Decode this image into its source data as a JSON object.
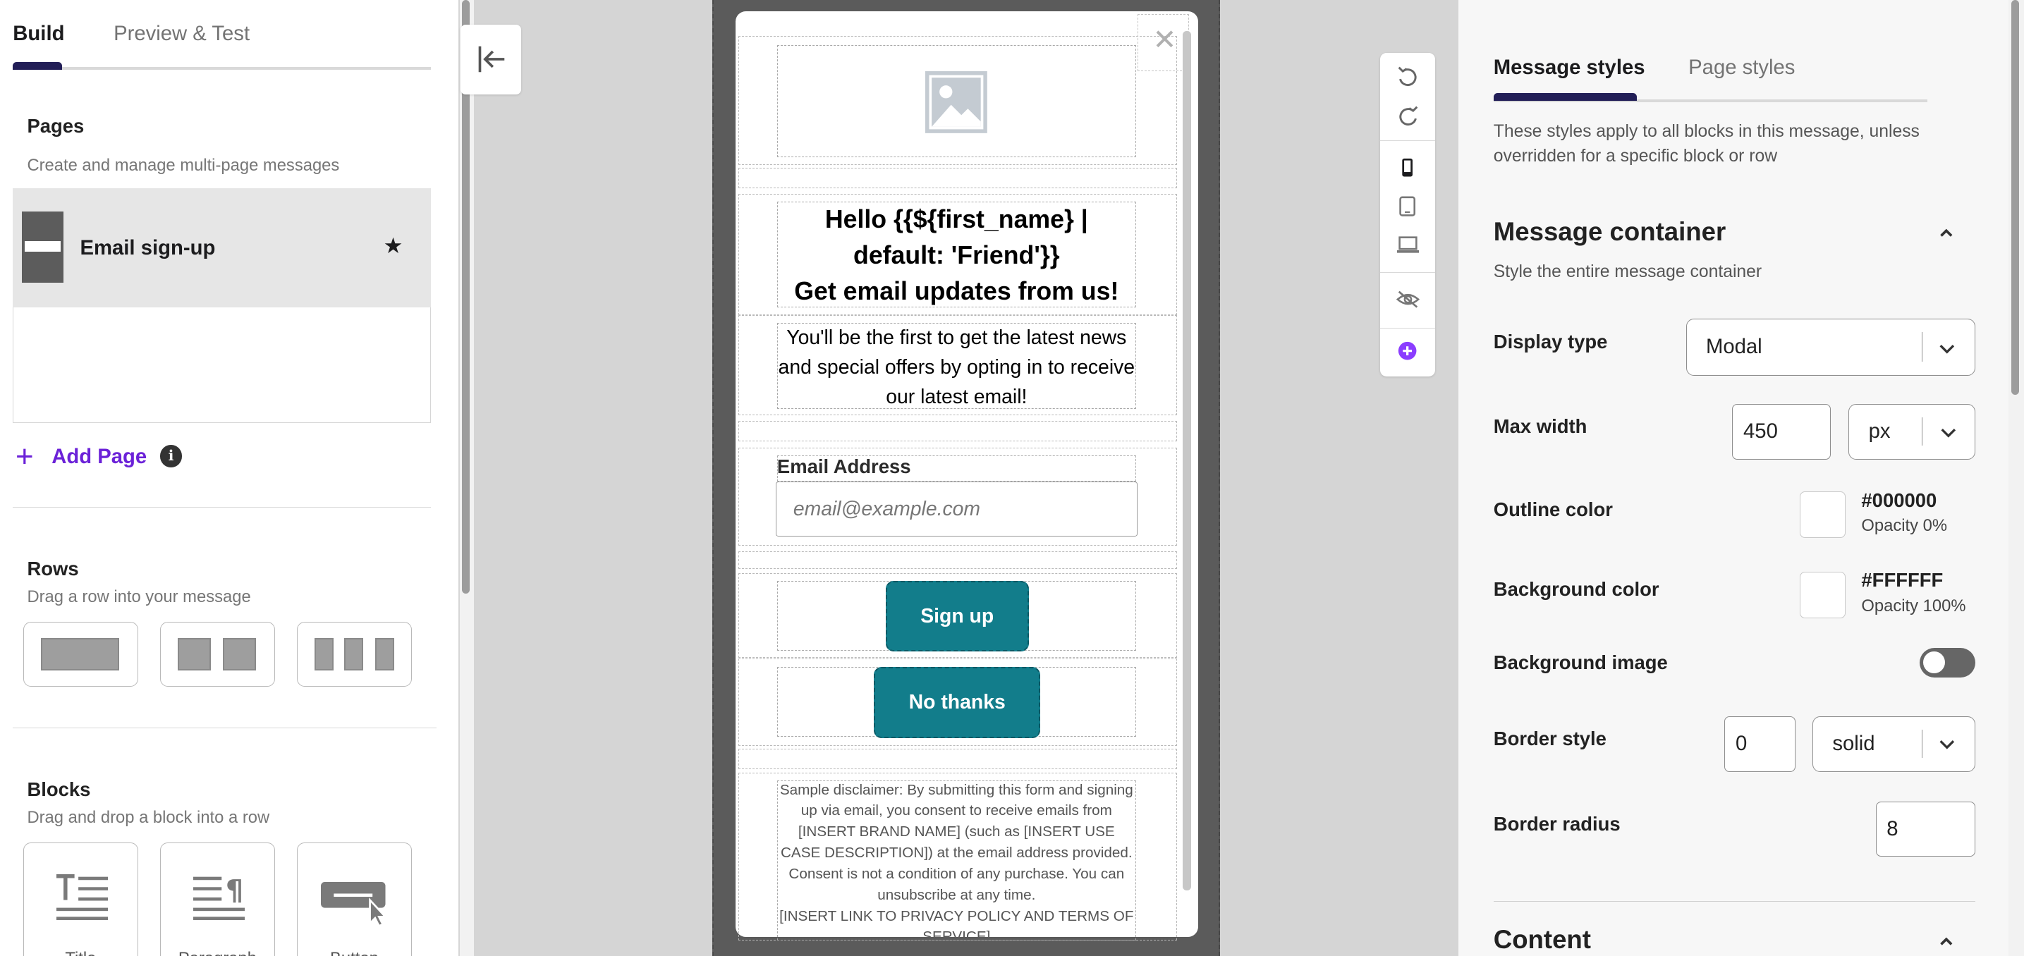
{
  "left_panel": {
    "tabs": [
      "Build",
      "Preview & Test"
    ],
    "pages": {
      "title": "Pages",
      "subtitle": "Create and manage multi-page messages",
      "items": [
        {
          "name": "Email sign-up"
        }
      ],
      "add_label": "Add Page"
    },
    "rows": {
      "title": "Rows",
      "subtitle": "Drag a row into your message"
    },
    "blocks": {
      "title": "Blocks",
      "subtitle": "Drag and drop a block into a row",
      "items": [
        "Title",
        "Paragraph",
        "Button"
      ]
    }
  },
  "canvas": {
    "headline": "Hello {{${first_name} | default: 'Friend'}}\nGet email updates from us!",
    "body": "You'll be the first to get the latest news and special offers by opting in to receive our latest email!",
    "email_label": "Email Address",
    "email_placeholder": "email@example.com",
    "signup_button": "Sign up",
    "no_thanks_button": "No thanks",
    "disclaimer": "Sample disclaimer: By submitting this form and signing up via email, you consent to receive emails from [INSERT BRAND NAME] (such as [INSERT USE CASE DESCRIPTION]) at the email address provided. Consent is not a condition of any purchase. You can unsubscribe at any time.\n[INSERT LINK TO PRIVACY POLICY AND TERMS OF SERVICE]",
    "button_color": "#127D8B"
  },
  "toolbar": {
    "icons": [
      "undo-icon",
      "redo-icon",
      "mobile-icon",
      "tablet-icon",
      "desktop-icon",
      "hide-icon",
      "add-circle-icon"
    ]
  },
  "right_panel": {
    "tabs": [
      "Message styles",
      "Page styles"
    ],
    "intro": "These styles apply to all blocks in this message, unless overridden for a specific block or row",
    "container": {
      "title": "Message container",
      "subtitle": "Style the entire message container",
      "display_type": {
        "label": "Display type",
        "value": "Modal"
      },
      "max_width": {
        "label": "Max width",
        "value": "450",
        "unit": "px"
      },
      "outline_color": {
        "label": "Outline color",
        "hex": "#000000",
        "opacity": "Opacity 0%"
      },
      "background_color": {
        "label": "Background color",
        "hex": "#FFFFFF",
        "opacity": "Opacity 100%"
      },
      "background_image": {
        "label": "Background image",
        "enabled": false
      },
      "border_style": {
        "label": "Border style",
        "width": "0",
        "style": "solid"
      },
      "border_radius": {
        "label": "Border radius",
        "value": "8"
      }
    },
    "content": {
      "title": "Content"
    }
  },
  "colors": {
    "accent": "#6B21D8",
    "tab_indicator": "#221E57",
    "brand_button": "#127D8B"
  }
}
